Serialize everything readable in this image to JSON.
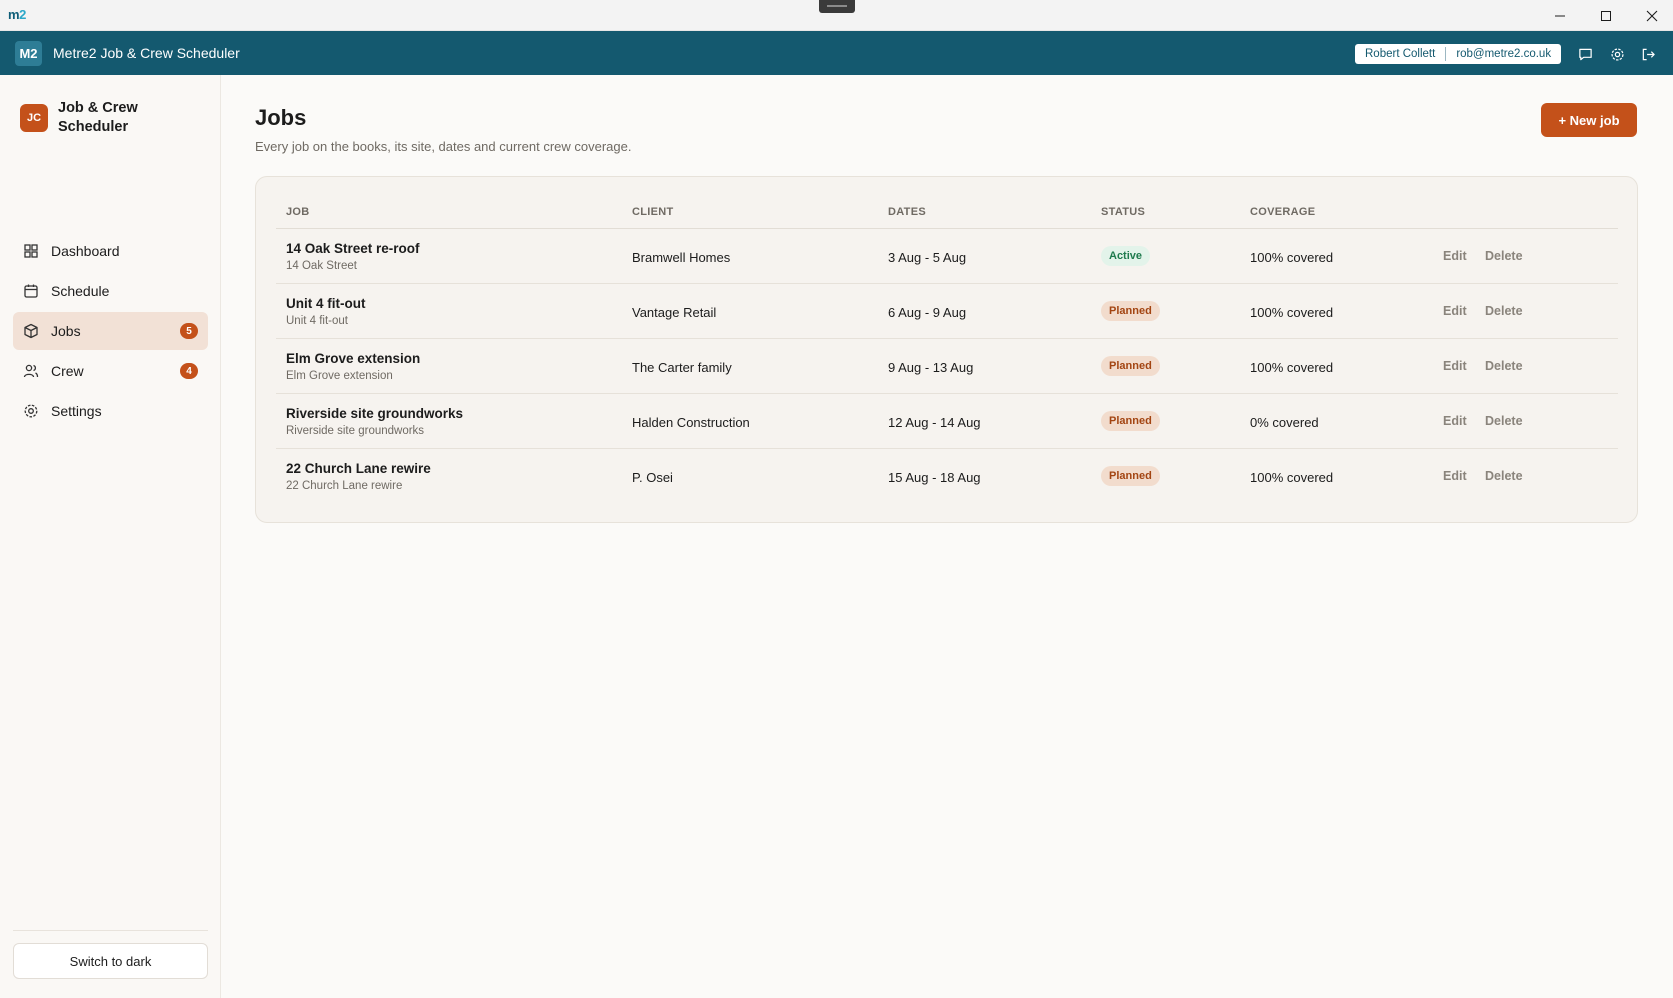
{
  "window": {
    "app_logo": "m",
    "app_logo_accent": "2"
  },
  "header": {
    "badge": "M2",
    "title": "Metre2 Job & Crew Scheduler",
    "user_name": "Robert Collett",
    "user_email": "rob@metre2.co.uk"
  },
  "sidebar": {
    "brand_logo": "JC",
    "brand_name": "Job & Crew Scheduler",
    "items": [
      {
        "label": "Dashboard",
        "icon": "grid-icon",
        "count": null,
        "active": false
      },
      {
        "label": "Schedule",
        "icon": "calendar-icon",
        "count": null,
        "active": false
      },
      {
        "label": "Jobs",
        "icon": "box-icon",
        "count": "5",
        "active": true
      },
      {
        "label": "Crew",
        "icon": "users-icon",
        "count": "4",
        "active": false
      },
      {
        "label": "Settings",
        "icon": "gear-icon",
        "count": null,
        "active": false
      }
    ],
    "theme_button": "Switch to dark"
  },
  "main": {
    "title": "Jobs",
    "subtitle": "Every job on the books, its site, dates and current crew coverage.",
    "new_button": "+ New job",
    "columns": [
      "JOB",
      "CLIENT",
      "DATES",
      "STATUS",
      "COVERAGE"
    ],
    "edit_label": "Edit",
    "delete_label": "Delete",
    "rows": [
      {
        "name": "14 Oak Street re-roof",
        "site": "14 Oak Street",
        "client": "Bramwell Homes",
        "dates": "3 Aug - 5 Aug",
        "status": "Active",
        "coverage": "100% covered"
      },
      {
        "name": "Unit 4 fit-out",
        "site": "Unit 4 fit-out",
        "client": "Vantage Retail",
        "dates": "6 Aug - 9 Aug",
        "status": "Planned",
        "coverage": "100% covered"
      },
      {
        "name": "Elm Grove extension",
        "site": "Elm Grove extension",
        "client": "The Carter family",
        "dates": "9 Aug - 13 Aug",
        "status": "Planned",
        "coverage": "100% covered"
      },
      {
        "name": "Riverside site groundworks",
        "site": "Riverside site groundworks",
        "client": "Halden Construction",
        "dates": "12 Aug - 14 Aug",
        "status": "Planned",
        "coverage": "0% covered"
      },
      {
        "name": "22 Church Lane rewire",
        "site": "22 Church Lane rewire",
        "client": "P. Osei",
        "dates": "15 Aug - 18 Aug",
        "status": "Planned",
        "coverage": "100% covered"
      }
    ]
  },
  "colors": {
    "header": "#14596f",
    "accent": "#c4511a",
    "active_status": "#1f7a4d",
    "planned_status": "#a34512"
  }
}
